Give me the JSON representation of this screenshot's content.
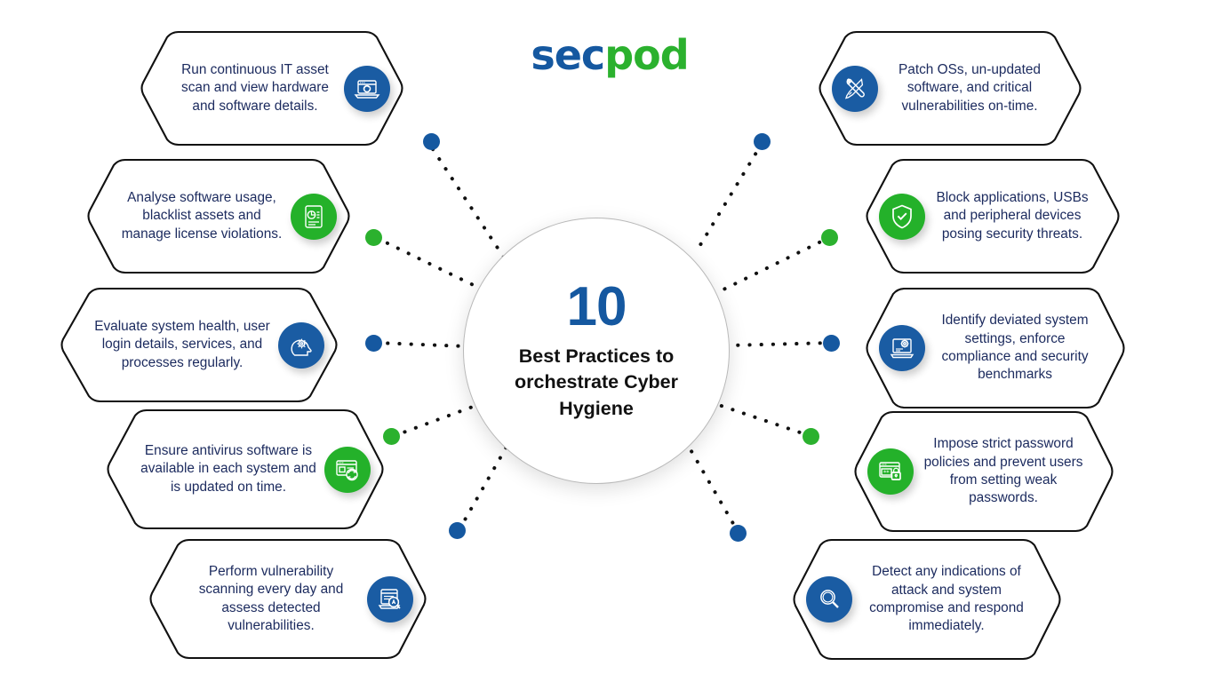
{
  "logo": {
    "part1": "sec",
    "part2": "pod",
    "color_blue": "#1558a0",
    "color_green": "#2bb12e"
  },
  "center": {
    "number": "10",
    "headline": "Best Practices to orchestrate Cyber Hygiene"
  },
  "theme": {
    "blue": "#1a5ca3",
    "green": "#24b12a",
    "text_navy": "#1b2a5e",
    "outline": "#111111",
    "background": "#ffffff"
  },
  "cards_left": [
    {
      "text": "Run continuous IT asset scan and view hardware and software details.",
      "icon": "laptop-scan-icon",
      "icon_color": "blue",
      "connector_dot_color": "blue"
    },
    {
      "text": "Analyse software usage, blacklist assets and manage license violations.",
      "icon": "report-chart-icon",
      "icon_color": "green",
      "connector_dot_color": "green"
    },
    {
      "text": "Evaluate system health, user login details, services, and processes regularly.",
      "icon": "head-gear-icon",
      "icon_color": "blue",
      "connector_dot_color": "blue"
    },
    {
      "text": "Ensure antivirus software is available in each system and is updated on time.",
      "icon": "window-refresh-icon",
      "icon_color": "green",
      "connector_dot_color": "green"
    },
    {
      "text": "Perform vulnerability scanning every day and assess detected vulnerabilities.",
      "icon": "laptop-magnifier-icon",
      "icon_color": "blue",
      "connector_dot_color": "blue"
    }
  ],
  "cards_right": [
    {
      "text": "Patch OSs, un-updated software, and critical vulnerabilities on-time.",
      "icon": "wrench-screwdriver-icon",
      "icon_color": "blue",
      "connector_dot_color": "blue"
    },
    {
      "text": "Block applications, USBs and peripheral devices posing security threats.",
      "icon": "shield-check-icon",
      "icon_color": "green",
      "connector_dot_color": "green"
    },
    {
      "text": "Identify deviated system settings, enforce compliance and security benchmarks",
      "icon": "laptop-gear-icon",
      "icon_color": "blue",
      "connector_dot_color": "blue"
    },
    {
      "text": "Impose strict password policies and prevent users from setting weak passwords.",
      "icon": "password-lock-icon",
      "icon_color": "green",
      "connector_dot_color": "green"
    },
    {
      "text": "Detect any indications of attack and system compromise and respond immediately.",
      "icon": "magnifier-icon",
      "icon_color": "blue",
      "connector_dot_color": "blue"
    }
  ]
}
